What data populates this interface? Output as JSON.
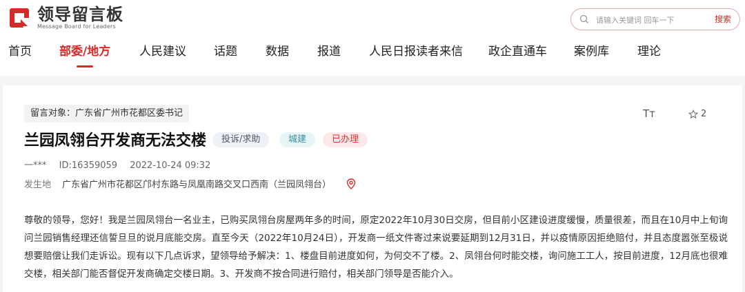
{
  "header": {
    "logo_title": "领导留言板",
    "logo_subtitle": "Message Board for Leaders",
    "brand_color": "#d42a2a"
  },
  "search": {
    "placeholder": "请输入关键词 回车一下",
    "button_label": "搜索"
  },
  "nav": {
    "items": [
      {
        "label": "首页",
        "active": false
      },
      {
        "label": "部委/地方",
        "active": true
      },
      {
        "label": "人民建议",
        "active": false
      },
      {
        "label": "话题",
        "active": false
      },
      {
        "label": "数据",
        "active": false
      },
      {
        "label": "报道",
        "active": false
      },
      {
        "label": "人民日报读者来信",
        "active": false
      },
      {
        "label": "政企直通车",
        "active": false
      },
      {
        "label": "案例库",
        "active": false
      },
      {
        "label": "理论",
        "active": false
      }
    ]
  },
  "message": {
    "target": "留言对象：广东省广州市花都区委书记",
    "font_size_icon": "Tт",
    "favorite_count": "2",
    "title": "兰园凤翎台开发商无法交楼",
    "tags": [
      "投诉/求助",
      "城建",
      "已办理"
    ],
    "author": "一***",
    "id": "ID:16359059",
    "datetime": "2022-10-24 09:32",
    "location_label": "发生地",
    "location": "广东省广州市花都区邝村东路与凤凰南路交叉口西南（兰园凤翎台）",
    "body": "尊敬的领导，您好！我是兰园凤翎台一名业主，已购买凤翎台房屋两年多的时间，原定2022年10月30日交房，但目前小区建设进度缓慢，质量很差，而且在10月中上旬询问兰园销售经理还信誓旦旦的说月底能交房。直至今天（2022年10月24日），开发商一纸文件寄过来说要延期到12月31日，并以疫情原因拒绝赔付，并且态度嚣张至极说想要赔偿让我们走诉讼。现有以下几点诉求，望领导给予解决：1、楼盘目前进度如何，为何交不了楼。2、凤翎台何时能交楼，询问施工工人，按目前进度，12月底也很难交楼，相关部门能否督促开发商确定交楼日期。3、开发商不按合同进行赔付，相关部门领导是否能介入。"
  }
}
